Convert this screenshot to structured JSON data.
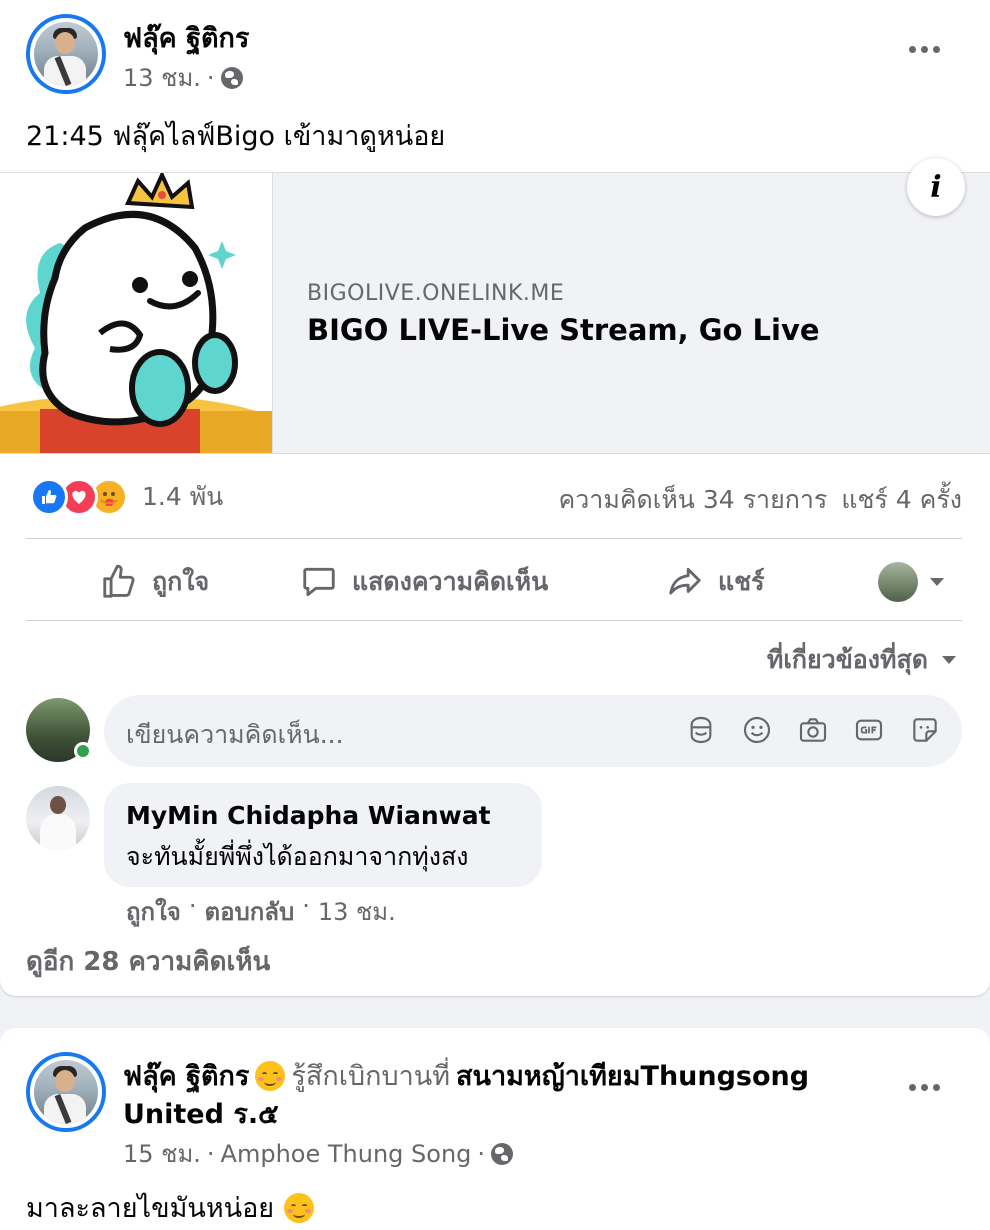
{
  "post1": {
    "author": "ฟลุ๊ค ฐิติกร",
    "time": "13 ชม.",
    "separator": "·",
    "text": "21:45 ฟลุ๊คไลฟ์Bigo เข้ามาดูหน่อย",
    "link": {
      "domain": "BIGOLIVE.ONELINK.ME",
      "title": "BIGO LIVE-Live Stream, Go Live",
      "info_icon": "i"
    },
    "reactions": {
      "icons": [
        "like-icon",
        "love-icon",
        "care-icon"
      ],
      "count": "1.4 พัน",
      "comments": "ความคิดเห็น 34 รายการ",
      "shares": "แชร์ 4 ครั้ง"
    },
    "actions": {
      "like": "ถูกใจ",
      "comment": "แสดงความคิดเห็น",
      "share": "แชร์"
    },
    "sort_label": "ที่เกี่ยวข้องที่สุด",
    "composer_placeholder": "เขียนความคิดเห็น...",
    "comment": {
      "name": "MyMin Chidapha Wianwat",
      "text": "จะทันมั้ยพี่พึ่งได้ออกมาจากทุ่งสง",
      "like": "ถูกใจ",
      "reply": "ตอบกลับ",
      "time": "13 ชม."
    },
    "more_comments": "ดูอีก 28 ความคิดเห็น"
  },
  "post2": {
    "author": "ฟลุ๊ค ฐิติกร",
    "feeling": "รู้สึกเบิกบานที่",
    "place_line1": "สนามหญ้าเทียมThungsong",
    "place_line2": "United ร.๕",
    "time": "15 ชม.",
    "location": "Amphoe Thung Song",
    "separator": "·",
    "text": "มาละลายไขมันหน่อย"
  },
  "colors": {
    "accent": "#1877f2",
    "secondary_text": "#65676b",
    "love": "#f33e58",
    "care": "#f7b125",
    "online": "#31a24c"
  }
}
